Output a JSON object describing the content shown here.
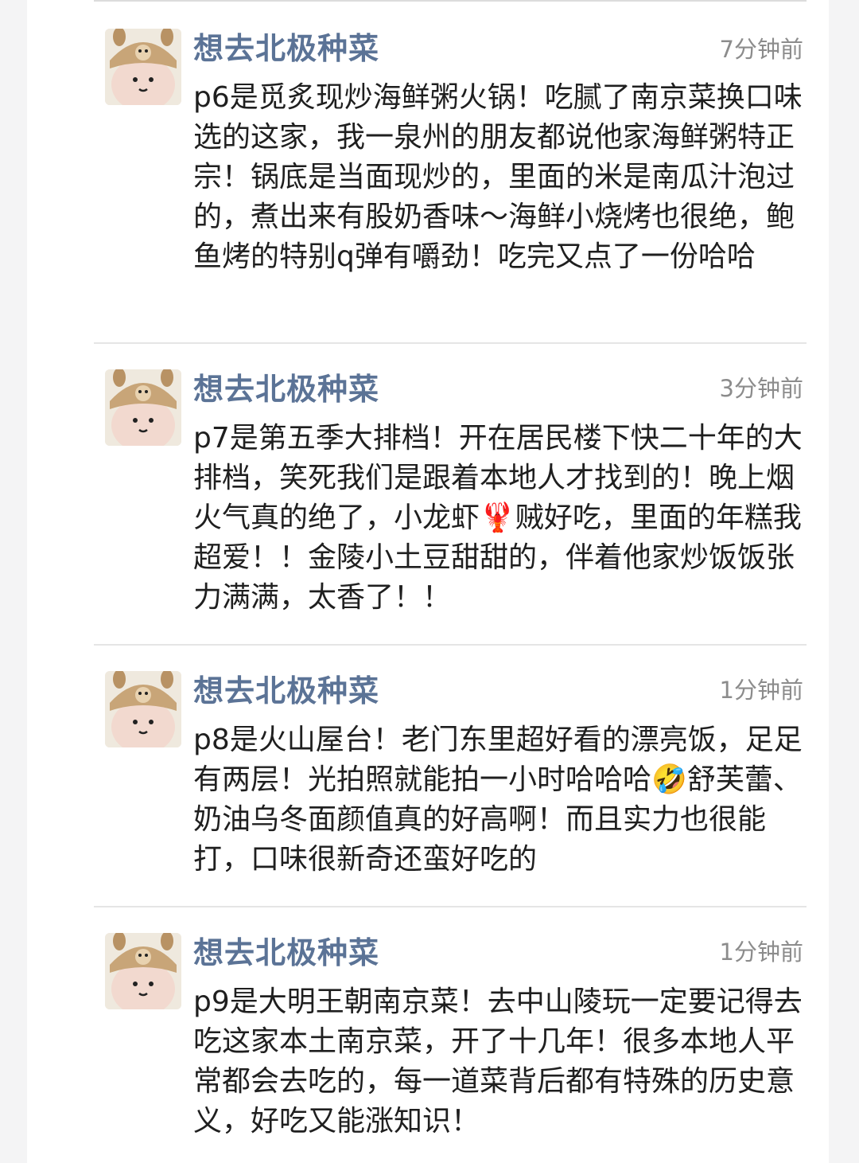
{
  "comments": [
    {
      "username": "想去北极种菜",
      "time": "7分钟前",
      "text_parts": [
        "p6是觅炙现炒海鲜粥火锅！吃腻了南京菜换口味选的这家，我一泉州的朋友都说他家海鲜粥特正宗！锅底是当面现炒的，里面的米是南瓜汁泡过的，煮出来有股奶香味～海鲜小烧烤也很绝，鲍鱼烤的特别q弹有嚼劲！吃完又点了一份哈哈"
      ]
    },
    {
      "username": "想去北极种菜",
      "time": "3分钟前",
      "text_parts": [
        "p7是第五季大排档！开在居民楼下快二十年的大排档，笑死我们是跟着本地人才找到的！晚上烟火气真的绝了，小龙虾",
        "贼好吃，里面的年糕我超爱！！金陵小土豆甜甜的，伴着他家炒饭饭张力满满，太香了！！"
      ],
      "emoji": "🦞",
      "emoji_name": "lobster-emoji"
    },
    {
      "username": "想去北极种菜",
      "time": "1分钟前",
      "text_parts": [
        "p8是火山屋台！老门东里超好看的漂亮饭，足足有两层！光拍照就能拍一小时哈哈哈",
        "舒芙蕾、奶油乌冬面颜值真的好高啊！而且实力也很能打，口味很新奇还蛮好吃的"
      ],
      "emoji": "🤣",
      "emoji_name": "rolling-laughing-emoji"
    },
    {
      "username": "想去北极种菜",
      "time": "1分钟前",
      "text_parts": [
        "p9是大明王朝南京菜！去中山陵玩一定要记得去吃这家本土南京菜，开了十几年！很多本地人平常都会去吃的，每一道菜背后都有特殊的历史意义，好吃又能涨知识！"
      ]
    }
  ],
  "colors": {
    "username": "#5b7396",
    "time": "#8c8c8c",
    "text": "#1f1f1f",
    "divider": "#e5e5e5"
  }
}
